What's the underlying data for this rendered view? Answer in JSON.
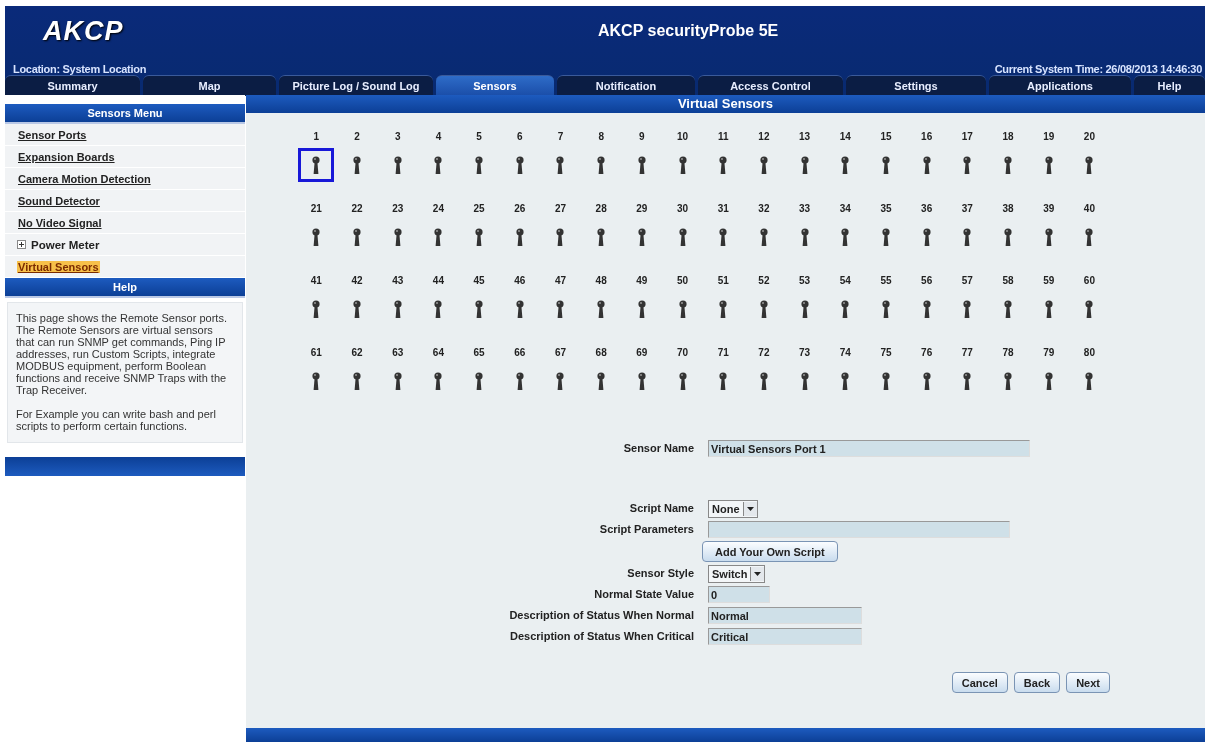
{
  "header": {
    "logo": "AKCP",
    "title": "AKCP securityProbe 5E",
    "location": "Location: System Location",
    "system_time": "Current System Time: 26/08/2013 14:46:30"
  },
  "tabs": [
    {
      "label": "Summary",
      "selected": false
    },
    {
      "label": "Map",
      "selected": false
    },
    {
      "label": "Picture Log / Sound Log",
      "selected": false
    },
    {
      "label": "Sensors",
      "selected": true
    },
    {
      "label": "Notification",
      "selected": false
    },
    {
      "label": "Access Control",
      "selected": false
    },
    {
      "label": "Settings",
      "selected": false
    },
    {
      "label": "Applications",
      "selected": false
    },
    {
      "label": "Help",
      "selected": false
    }
  ],
  "page_title": "Virtual Sensors",
  "sidebar": {
    "menu_title": "Sensors Menu",
    "items": [
      {
        "label": "Sensor Ports",
        "kind": "link",
        "selected": false
      },
      {
        "label": "Expansion Boards",
        "kind": "link",
        "selected": false
      },
      {
        "label": "Camera Motion Detection",
        "kind": "link",
        "selected": false
      },
      {
        "label": "Sound Detector",
        "kind": "link",
        "selected": false
      },
      {
        "label": "No Video Signal",
        "kind": "link",
        "selected": false
      },
      {
        "label": "Power Meter",
        "kind": "group",
        "expanded": false,
        "selected": false
      },
      {
        "label": "Virtual Sensors",
        "kind": "link",
        "selected": true
      }
    ],
    "help_title": "Help",
    "help_paragraphs": [
      "This page shows the Remote Sensor ports. The Remote Sensors are virtual sensors that can run SNMP get commands, Ping IP addresses, run Custom Scripts, integrate MODBUS equipment, perform Boolean functions and receive SNMP Traps with the Trap Receiver.",
      "For Example you can write bash and perl scripts to perform certain functions."
    ]
  },
  "sensors": [
    {
      "number": "1",
      "selected": true
    },
    {
      "number": "2",
      "selected": false
    },
    {
      "number": "3",
      "selected": false
    },
    {
      "number": "4",
      "selected": false
    },
    {
      "number": "5",
      "selected": false
    },
    {
      "number": "6",
      "selected": false
    },
    {
      "number": "7",
      "selected": false
    },
    {
      "number": "8",
      "selected": false
    },
    {
      "number": "9",
      "selected": false
    },
    {
      "number": "10",
      "selected": false
    },
    {
      "number": "11",
      "selected": false
    },
    {
      "number": "12",
      "selected": false
    },
    {
      "number": "13",
      "selected": false
    },
    {
      "number": "14",
      "selected": false
    },
    {
      "number": "15",
      "selected": false
    },
    {
      "number": "16",
      "selected": false
    },
    {
      "number": "17",
      "selected": false
    },
    {
      "number": "18",
      "selected": false
    },
    {
      "number": "19",
      "selected": false
    },
    {
      "number": "20",
      "selected": false
    },
    {
      "number": "21",
      "selected": false
    },
    {
      "number": "22",
      "selected": false
    },
    {
      "number": "23",
      "selected": false
    },
    {
      "number": "24",
      "selected": false
    },
    {
      "number": "25",
      "selected": false
    },
    {
      "number": "26",
      "selected": false
    },
    {
      "number": "27",
      "selected": false
    },
    {
      "number": "28",
      "selected": false
    },
    {
      "number": "29",
      "selected": false
    },
    {
      "number": "30",
      "selected": false
    },
    {
      "number": "31",
      "selected": false
    },
    {
      "number": "32",
      "selected": false
    },
    {
      "number": "33",
      "selected": false
    },
    {
      "number": "34",
      "selected": false
    },
    {
      "number": "35",
      "selected": false
    },
    {
      "number": "36",
      "selected": false
    },
    {
      "number": "37",
      "selected": false
    },
    {
      "number": "38",
      "selected": false
    },
    {
      "number": "39",
      "selected": false
    },
    {
      "number": "40",
      "selected": false
    },
    {
      "number": "41",
      "selected": false
    },
    {
      "number": "42",
      "selected": false
    },
    {
      "number": "43",
      "selected": false
    },
    {
      "number": "44",
      "selected": false
    },
    {
      "number": "45",
      "selected": false
    },
    {
      "number": "46",
      "selected": false
    },
    {
      "number": "47",
      "selected": false
    },
    {
      "number": "48",
      "selected": false
    },
    {
      "number": "49",
      "selected": false
    },
    {
      "number": "50",
      "selected": false
    },
    {
      "number": "51",
      "selected": false
    },
    {
      "number": "52",
      "selected": false
    },
    {
      "number": "53",
      "selected": false
    },
    {
      "number": "54",
      "selected": false
    },
    {
      "number": "55",
      "selected": false
    },
    {
      "number": "56",
      "selected": false
    },
    {
      "number": "57",
      "selected": false
    },
    {
      "number": "58",
      "selected": false
    },
    {
      "number": "59",
      "selected": false
    },
    {
      "number": "60",
      "selected": false
    },
    {
      "number": "61",
      "selected": false
    },
    {
      "number": "62",
      "selected": false
    },
    {
      "number": "63",
      "selected": false
    },
    {
      "number": "64",
      "selected": false
    },
    {
      "number": "65",
      "selected": false
    },
    {
      "number": "66",
      "selected": false
    },
    {
      "number": "67",
      "selected": false
    },
    {
      "number": "68",
      "selected": false
    },
    {
      "number": "69",
      "selected": false
    },
    {
      "number": "70",
      "selected": false
    },
    {
      "number": "71",
      "selected": false
    },
    {
      "number": "72",
      "selected": false
    },
    {
      "number": "73",
      "selected": false
    },
    {
      "number": "74",
      "selected": false
    },
    {
      "number": "75",
      "selected": false
    },
    {
      "number": "76",
      "selected": false
    },
    {
      "number": "77",
      "selected": false
    },
    {
      "number": "78",
      "selected": false
    },
    {
      "number": "79",
      "selected": false
    },
    {
      "number": "80",
      "selected": false
    }
  ],
  "form": {
    "sections": [
      [
        {
          "kind": "text",
          "label": "Sensor Name",
          "value": "Virtual Sensors Port 1"
        }
      ],
      [
        {
          "kind": "select",
          "label": "Script Name",
          "value": "None"
        },
        {
          "kind": "text",
          "label": "Script Parameters"
        },
        {
          "kind": "button",
          "label": "Add Your Own Script"
        },
        {
          "kind": "select",
          "label": "Sensor Style",
          "value": "Switch"
        },
        {
          "kind": "text",
          "label": "Normal State Value",
          "value": "0"
        },
        {
          "kind": "text",
          "label": "Description of Status When Normal",
          "value": "Normal"
        },
        {
          "kind": "text",
          "label": "Description of Status When Critical",
          "value": "Critical"
        }
      ]
    ],
    "buttons": [
      "Cancel",
      "Back",
      "Next"
    ]
  }
}
